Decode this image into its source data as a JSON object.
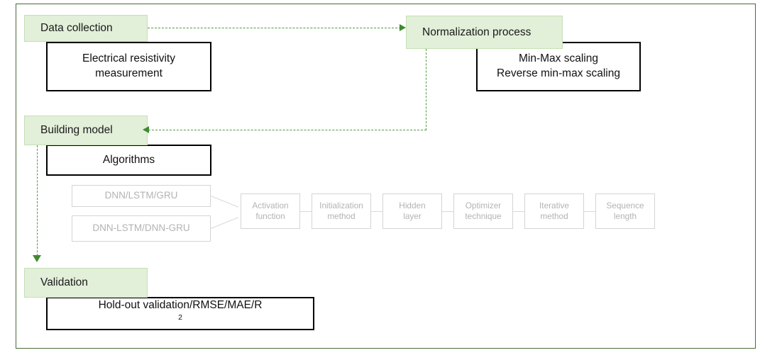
{
  "figure": {
    "type": "flowchart",
    "colors": {
      "stage_fill": "#e2efd9",
      "stage_border": "#c5e0b4",
      "detail_border": "#000000",
      "grey_box_border": "#d4d4d4",
      "grey_box_text": "#b3b3b3",
      "connector_green": "#4f9a3f",
      "frame_border": "#4a6a38",
      "background": "#ffffff"
    }
  },
  "stages": {
    "data_collection": {
      "label": "Data collection",
      "detail_line1": "Electrical resistivity",
      "detail_line2": "measurement"
    },
    "normalization": {
      "label": "Normalization process",
      "detail_line1": "Min-Max scaling",
      "detail_line2": "Reverse min-max scaling"
    },
    "building_model": {
      "label": "Building model",
      "detail_line1": "Algorithms"
    },
    "validation": {
      "label": "Validation",
      "detail_line1": "Hold-out validation/RMSE/MAE/R",
      "detail_superscript": "2"
    }
  },
  "algorithms": [
    {
      "label": "DNN/LSTM/GRU"
    },
    {
      "label": "DNN-LSTM/DNN-GRU"
    }
  ],
  "hyperparameters": [
    {
      "line1": "Activation",
      "line2": "function"
    },
    {
      "line1": "Initialization",
      "line2": "method"
    },
    {
      "line1": "Hidden",
      "line2": "layer"
    },
    {
      "line1": "Optimizer",
      "line2": "technique"
    },
    {
      "line1": "Iterative",
      "line2": "method"
    },
    {
      "line1": "Sequence",
      "line2": "length"
    }
  ],
  "connectors": [
    {
      "name": "data-collection-to-normalization",
      "style": "dashed",
      "direction": "right"
    },
    {
      "name": "normalization-to-building-model",
      "style": "dashed",
      "direction": "left"
    },
    {
      "name": "building-model-to-validation",
      "style": "dashed",
      "direction": "down"
    }
  ]
}
